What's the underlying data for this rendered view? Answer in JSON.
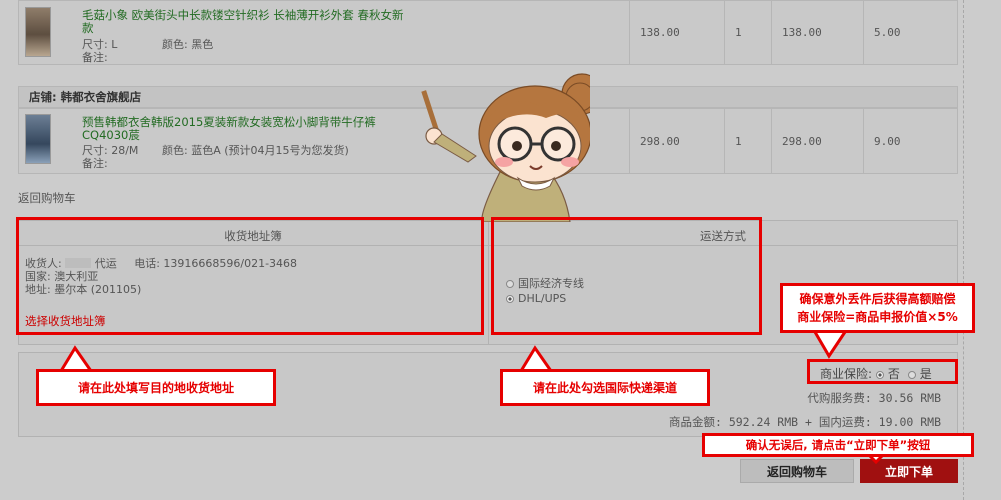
{
  "products": [
    {
      "title": "毛菇小象 欧美街头中长款镂空针织衫 长袖薄开衫外套 春秋女新款",
      "size": "尺寸: L",
      "color": "颜色: 黑色",
      "note": "备注:",
      "price": "138.00",
      "qty": "1",
      "subtotal": "138.00",
      "shipping": "5.00"
    },
    {
      "title": "预售韩都衣舍韩版2015夏装新款女装宽松小脚背带牛仔裤 CQ4030莀",
      "size": "尺寸: 28/M",
      "color": "颜色: 蓝色A (预计04月15号为您发货)",
      "note": "备注:",
      "price": "298.00",
      "qty": "1",
      "subtotal": "298.00",
      "shipping": "9.00"
    }
  ],
  "shop_name": "店铺: 韩都衣舍旗舰店",
  "back_link": "返回购物车",
  "address": {
    "header": "收货地址簿",
    "receiver_label": "收货人:",
    "receiver_name": "代运",
    "phone": "电话: 13916668596/021-3468",
    "country": "国家: 澳大利亚",
    "addr": "地址: 墨尔本 (201105)",
    "select_link": "选择收货地址簿"
  },
  "shipping_method": {
    "header": "运送方式",
    "options": [
      "国际经济专线",
      "DHL/UPS"
    ],
    "selected": "DHL/UPS"
  },
  "insurance": {
    "label": "商业保险:",
    "no": "否",
    "yes": "是",
    "selected": "否"
  },
  "fees": {
    "service_fee": "代购服务费: 30.56 RMB",
    "totals": "商品金额: 592.24 RMB + 国内运费: 19.00 RMB"
  },
  "callouts": {
    "address": "请在此处填写目的地收货地址",
    "shipping": "请在此处勾选国际快递渠道",
    "insurance_line1": "确保意外丢件后获得高额赔偿",
    "insurance_line2": "商业保险=商品申报价值×5%",
    "order": "确认无误后, 请点击“立即下单”按钮"
  },
  "buttons": {
    "back": "返回购物车",
    "order": "立即下单"
  },
  "colors": {
    "callout_red": "#e60000",
    "order_button": "#a01010",
    "title_green": "#226b22",
    "link_red": "#cc0000"
  }
}
